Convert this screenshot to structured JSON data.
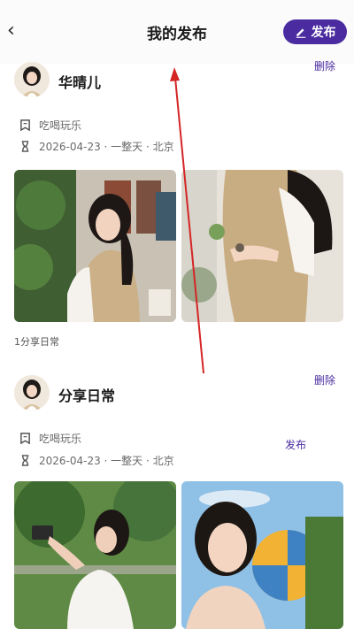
{
  "header": {
    "title": "我的发布",
    "publish_label": "发布"
  },
  "posts": [
    {
      "username": "华晴儿",
      "delete_label": "删除",
      "category": "吃喝玩乐",
      "details": "2026-04-23 · 一整天 · 北京",
      "caption": "1分享日常"
    },
    {
      "username": "分享日常",
      "delete_label": "删除",
      "category": "吃喝玩乐",
      "details": "2026-04-23 · 一整天 · 北京",
      "publish_label": "发布"
    }
  ],
  "colors": {
    "accent": "#4a2ca0",
    "annotation_arrow": "#d42525"
  }
}
